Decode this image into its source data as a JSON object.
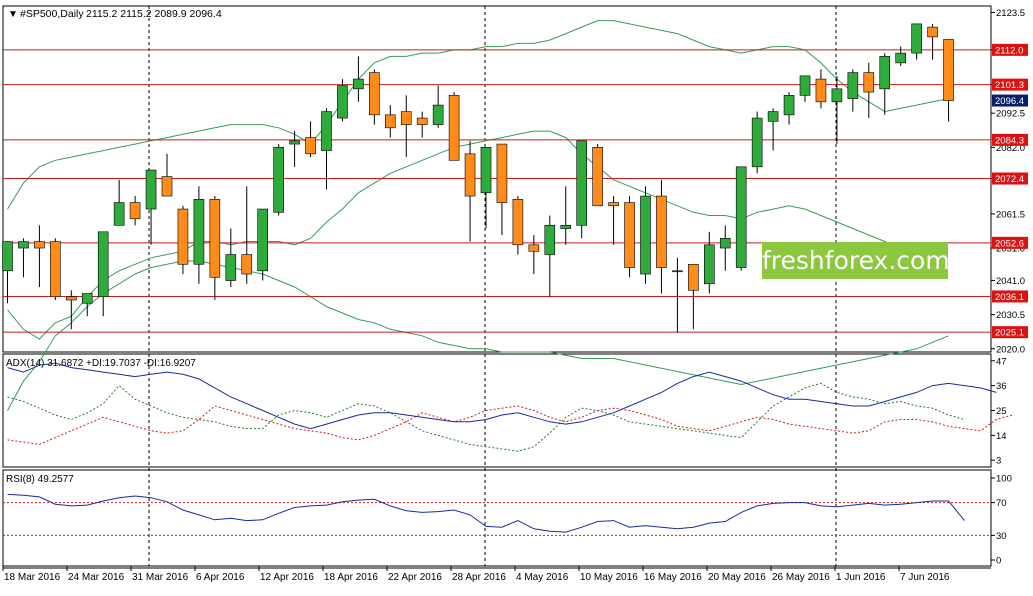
{
  "chart_data": [
    {
      "type": "candlestick",
      "panel": "price",
      "title": "#SP500,Daily",
      "ohlc_readout": [
        "2115.2",
        "2115.2",
        "2089.9",
        "2096.4"
      ],
      "y_tick_labels": [
        "2123.5",
        "2112.0",
        "2101.3",
        "2092.5",
        "2082.0",
        "2072.4",
        "2061.5",
        "2051.0",
        "2041.0",
        "2030.5",
        "2020.0"
      ],
      "ylim": [
        2019,
        2125.5
      ],
      "horizontal_levels": [
        {
          "value": 2112.0,
          "label": "2112.0"
        },
        {
          "value": 2101.3,
          "label": "2101.3"
        },
        {
          "value": 2084.3,
          "label": "2084.3"
        },
        {
          "value": 2072.4,
          "label": "2072.4"
        },
        {
          "value": 2052.6,
          "label": "2052.6"
        },
        {
          "value": 2036.1,
          "label": "2036.1"
        },
        {
          "value": 2025.1,
          "label": "2025.1"
        }
      ],
      "current_price": {
        "value": 2096.4,
        "label": "2096.4"
      },
      "candles": [
        {
          "o": 2044,
          "h": 2051,
          "l": 2034,
          "c": 2053
        },
        {
          "o": 2051,
          "h": 2054,
          "l": 2042,
          "c": 2053
        },
        {
          "o": 2053,
          "h": 2058,
          "l": 2039,
          "c": 2051
        },
        {
          "o": 2053,
          "h": 2054,
          "l": 2035,
          "c": 2036
        },
        {
          "o": 2036,
          "h": 2038,
          "l": 2026,
          "c": 2035
        },
        {
          "o": 2034,
          "h": 2037,
          "l": 2030,
          "c": 2037
        },
        {
          "o": 2036,
          "h": 2056,
          "l": 2030,
          "c": 2056
        },
        {
          "o": 2058,
          "h": 2072,
          "l": 2058,
          "c": 2065
        },
        {
          "o": 2065,
          "h": 2067,
          "l": 2058,
          "c": 2060
        },
        {
          "o": 2063,
          "h": 2075,
          "l": 2052,
          "c": 2075
        },
        {
          "o": 2073,
          "h": 2080,
          "l": 2067,
          "c": 2067
        },
        {
          "o": 2063,
          "h": 2064,
          "l": 2043,
          "c": 2046
        },
        {
          "o": 2046,
          "h": 2070,
          "l": 2040,
          "c": 2066
        },
        {
          "o": 2066,
          "h": 2067,
          "l": 2035,
          "c": 2042
        },
        {
          "o": 2041,
          "h": 2057,
          "l": 2039,
          "c": 2049
        },
        {
          "o": 2049,
          "h": 2070,
          "l": 2040,
          "c": 2043
        },
        {
          "o": 2044,
          "h": 2063,
          "l": 2041,
          "c": 2063
        },
        {
          "o": 2062,
          "h": 2083,
          "l": 2061,
          "c": 2082
        },
        {
          "o": 2083,
          "h": 2087,
          "l": 2076,
          "c": 2084
        },
        {
          "o": 2085,
          "h": 2090,
          "l": 2079,
          "c": 2080
        },
        {
          "o": 2081,
          "h": 2094,
          "l": 2069,
          "c": 2093
        },
        {
          "o": 2091,
          "h": 2103,
          "l": 2090,
          "c": 2101
        },
        {
          "o": 2100,
          "h": 2110,
          "l": 2096,
          "c": 2103
        },
        {
          "o": 2105,
          "h": 2106,
          "l": 2089,
          "c": 2092
        },
        {
          "o": 2092,
          "h": 2095,
          "l": 2085,
          "c": 2088
        },
        {
          "o": 2093,
          "h": 2098,
          "l": 2079,
          "c": 2089
        },
        {
          "o": 2091,
          "h": 2093,
          "l": 2085,
          "c": 2089
        },
        {
          "o": 2089,
          "h": 2101,
          "l": 2088,
          "c": 2095
        },
        {
          "o": 2098,
          "h": 2099,
          "l": 2086,
          "c": 2078
        },
        {
          "o": 2080,
          "h": 2084,
          "l": 2053,
          "c": 2067
        },
        {
          "o": 2068,
          "h": 2082,
          "l": 2057,
          "c": 2082
        },
        {
          "o": 2083,
          "h": 2083,
          "l": 2055,
          "c": 2065
        },
        {
          "o": 2066,
          "h": 2067,
          "l": 2049,
          "c": 2052
        },
        {
          "o": 2052,
          "h": 2055,
          "l": 2043,
          "c": 2050
        },
        {
          "o": 2049,
          "h": 2061,
          "l": 2036,
          "c": 2058
        },
        {
          "o": 2057,
          "h": 2070,
          "l": 2052,
          "c": 2058
        },
        {
          "o": 2058,
          "h": 2084,
          "l": 2054,
          "c": 2084
        },
        {
          "o": 2082,
          "h": 2083,
          "l": 2068,
          "c": 2064
        },
        {
          "o": 2065,
          "h": 2067,
          "l": 2052,
          "c": 2064
        },
        {
          "o": 2065,
          "h": 2067,
          "l": 2042,
          "c": 2045
        },
        {
          "o": 2043,
          "h": 2070,
          "l": 2040,
          "c": 2067
        },
        {
          "o": 2067,
          "h": 2072,
          "l": 2037,
          "c": 2045
        },
        {
          "o": 2044,
          "h": 2048,
          "l": 2025,
          "c": 2044
        },
        {
          "o": 2046,
          "h": 2046,
          "l": 2026,
          "c": 2038
        },
        {
          "o": 2040,
          "h": 2056,
          "l": 2037,
          "c": 2052
        },
        {
          "o": 2051,
          "h": 2058,
          "l": 2044,
          "c": 2054
        },
        {
          "o": 2045,
          "h": 2052,
          "l": 2044,
          "c": 2076
        },
        {
          "o": 2076,
          "h": 2093,
          "l": 2074,
          "c": 2091
        },
        {
          "o": 2090,
          "h": 2094,
          "l": 2081,
          "c": 2093
        },
        {
          "o": 2092,
          "h": 2099,
          "l": 2089,
          "c": 2098
        },
        {
          "o": 2098,
          "h": 2104,
          "l": 2096,
          "c": 2104
        },
        {
          "o": 2103,
          "h": 2106,
          "l": 2094,
          "c": 2096
        },
        {
          "o": 2096,
          "h": 2104,
          "l": 2083,
          "c": 2100
        },
        {
          "o": 2097,
          "h": 2106,
          "l": 2093,
          "c": 2105
        },
        {
          "o": 2105,
          "h": 2108,
          "l": 2091,
          "c": 2099
        },
        {
          "o": 2100,
          "h": 2111,
          "l": 2092,
          "c": 2110
        },
        {
          "o": 2108,
          "h": 2113,
          "l": 2107,
          "c": 2111
        },
        {
          "o": 2111,
          "h": 2120,
          "l": 2109,
          "c": 2120
        },
        {
          "o": 2119,
          "h": 2120,
          "l": 2109,
          "c": 2116
        },
        {
          "o": 2115.2,
          "h": 2115.2,
          "l": 2089.9,
          "c": 2096.4
        }
      ],
      "bollinger": {
        "upper": [
          2063,
          2071,
          2076,
          2078,
          2079,
          2080,
          2081,
          2082,
          2083,
          2084,
          2085,
          2086,
          2087,
          2088,
          2089,
          2089,
          2089,
          2088,
          2086,
          2083,
          2089,
          2096,
          2103,
          2108,
          2110,
          2110,
          2111,
          2111,
          2112,
          2112,
          2113,
          2113,
          2114,
          2114,
          2115,
          2117,
          2119,
          2121,
          2121,
          2120,
          2119,
          2118,
          2117,
          2115,
          2113,
          2112,
          2111,
          2112,
          2113,
          2113,
          2112,
          2108,
          2103,
          2099,
          2096,
          2093,
          2094,
          2095,
          2096,
          2097
        ],
        "middle": [
          2032,
          2026,
          2023,
          2028,
          2030,
          2036,
          2041,
          2044,
          2046,
          2048,
          2049,
          2050,
          2053,
          2053,
          2052,
          2053,
          2053,
          2053,
          2052,
          2054,
          2059,
          2063,
          2068,
          2071,
          2074,
          2076,
          2078,
          2080,
          2082,
          2083,
          2084,
          2085,
          2086,
          2087,
          2087,
          2085,
          2080,
          2076,
          2072,
          2070,
          2068,
          2066,
          2064,
          2062,
          2061,
          2061,
          2060,
          2062,
          2063,
          2064,
          2063,
          2061,
          2059,
          2057,
          2055,
          2053,
          2051,
          2049,
          2047,
          2046
        ],
        "lower": [
          2001,
          2010,
          2016,
          2024,
          2028,
          2033,
          2037,
          2040,
          2043,
          2045,
          2046,
          2047,
          2047,
          2046,
          2045,
          2044,
          2043,
          2041,
          2039,
          2036,
          2033,
          2031,
          2029,
          2028,
          2026,
          2025,
          2024,
          2022,
          2021,
          2020,
          2020,
          2019,
          2019,
          2019,
          2019,
          2018,
          2017,
          2017,
          2017,
          2016,
          2015,
          2014,
          2013,
          2012,
          2011,
          2010,
          2009,
          2010,
          2011,
          2012,
          2013,
          2014,
          2015,
          2016,
          2017,
          2018,
          2019,
          2020,
          2022,
          2024
        ]
      }
    },
    {
      "type": "line",
      "panel": "adx",
      "title": "ADX(14) 31.6872 +DI:19.7037 -DI:16.9207",
      "y_tick_labels": [
        "47",
        "36",
        "25",
        "14",
        "3"
      ],
      "ylim": [
        0,
        50
      ],
      "levels": [],
      "series": [
        {
          "values": [
            44,
            42,
            45,
            46,
            44,
            43,
            42,
            41,
            40,
            41,
            42,
            41,
            39,
            35,
            31,
            28,
            25,
            22,
            19,
            17,
            19,
            21,
            23,
            24,
            24,
            23,
            22,
            21,
            20,
            20,
            21,
            23,
            24,
            22,
            20,
            19,
            20,
            22,
            24,
            27,
            30,
            33,
            37,
            40,
            42,
            40,
            38,
            35,
            32,
            30,
            30,
            29,
            28,
            27,
            27,
            29,
            31,
            33,
            36,
            37,
            36,
            35,
            33
          ]
        },
        {
          "values": [
            31,
            29,
            26,
            23,
            21,
            24,
            28,
            36,
            30,
            27,
            24,
            22,
            21,
            20,
            18,
            17,
            17,
            23,
            25,
            24,
            22,
            25,
            28,
            27,
            24,
            20,
            16,
            14,
            12,
            10,
            9,
            8,
            7,
            9,
            15,
            22,
            26,
            25,
            23,
            20,
            19,
            18,
            17,
            16,
            15,
            14,
            13,
            20,
            27,
            31,
            35,
            37,
            33,
            31,
            30,
            28,
            29,
            27,
            26,
            23,
            21
          ]
        },
        {
          "values": [
            12,
            11,
            10,
            13,
            16,
            19,
            22,
            20,
            18,
            16,
            15,
            16,
            21,
            27,
            25,
            23,
            21,
            19,
            17,
            16,
            15,
            13,
            12,
            14,
            17,
            20,
            24,
            22,
            20,
            22,
            25,
            26,
            27,
            25,
            22,
            20,
            22,
            25,
            26,
            25,
            23,
            21,
            18,
            17,
            16,
            18,
            20,
            22,
            21,
            19,
            18,
            17,
            16,
            15,
            16,
            20,
            21,
            21,
            20,
            18,
            17,
            16,
            21,
            23
          ]
        }
      ]
    },
    {
      "type": "line",
      "panel": "rsi",
      "title": "RSI(8) 49.2577",
      "y_tick_labels": [
        "100",
        "70",
        "30",
        "0"
      ],
      "ylim": [
        0,
        100
      ],
      "levels": [
        70,
        30
      ],
      "series": [
        {
          "values": [
            80,
            79,
            77,
            68,
            66,
            67,
            72,
            76,
            78,
            76,
            71,
            61,
            55,
            49,
            51,
            48,
            49,
            57,
            64,
            66,
            67,
            71,
            73,
            74,
            66,
            60,
            58,
            59,
            61,
            55,
            41,
            40,
            48,
            38,
            35,
            34,
            40,
            47,
            48,
            40,
            42,
            40,
            38,
            40,
            45,
            47,
            58,
            66,
            69,
            70,
            70,
            66,
            65,
            67,
            69,
            67,
            68,
            70,
            72,
            72,
            48
          ]
        }
      ]
    }
  ],
  "x_axis": {
    "date_labels": [
      "18 Mar 2016",
      "24 Mar 2016",
      "31 Mar 2016",
      "6 Apr 2016",
      "12 Apr 2016",
      "18 Apr 2016",
      "22 Apr 2016",
      "28 Apr 2016",
      "4 May 2016",
      "10 May 2016",
      "16 May 2016",
      "20 May 2016",
      "26 May 2016",
      "1 Jun 2016",
      "7 Jun 2016"
    ]
  },
  "watermark": {
    "text": "freshforex.com"
  },
  "colors": {
    "bull": "#2eab3b",
    "bear": "#ff8c1a",
    "level_line": "#cc1a1a",
    "level_label_bg": "#dd1111",
    "current_label_bg": "#0a1f6a",
    "bollinger": "#3a9a58",
    "adx_main": "#1a2aa0",
    "adx_plus_di": "#2a7a2a",
    "adx_minus_di": "#d01a1a",
    "rsi_line": "#1a2aa0",
    "rsi_level": "#d01a1a",
    "watermark_bg": "#8dc63f"
  }
}
